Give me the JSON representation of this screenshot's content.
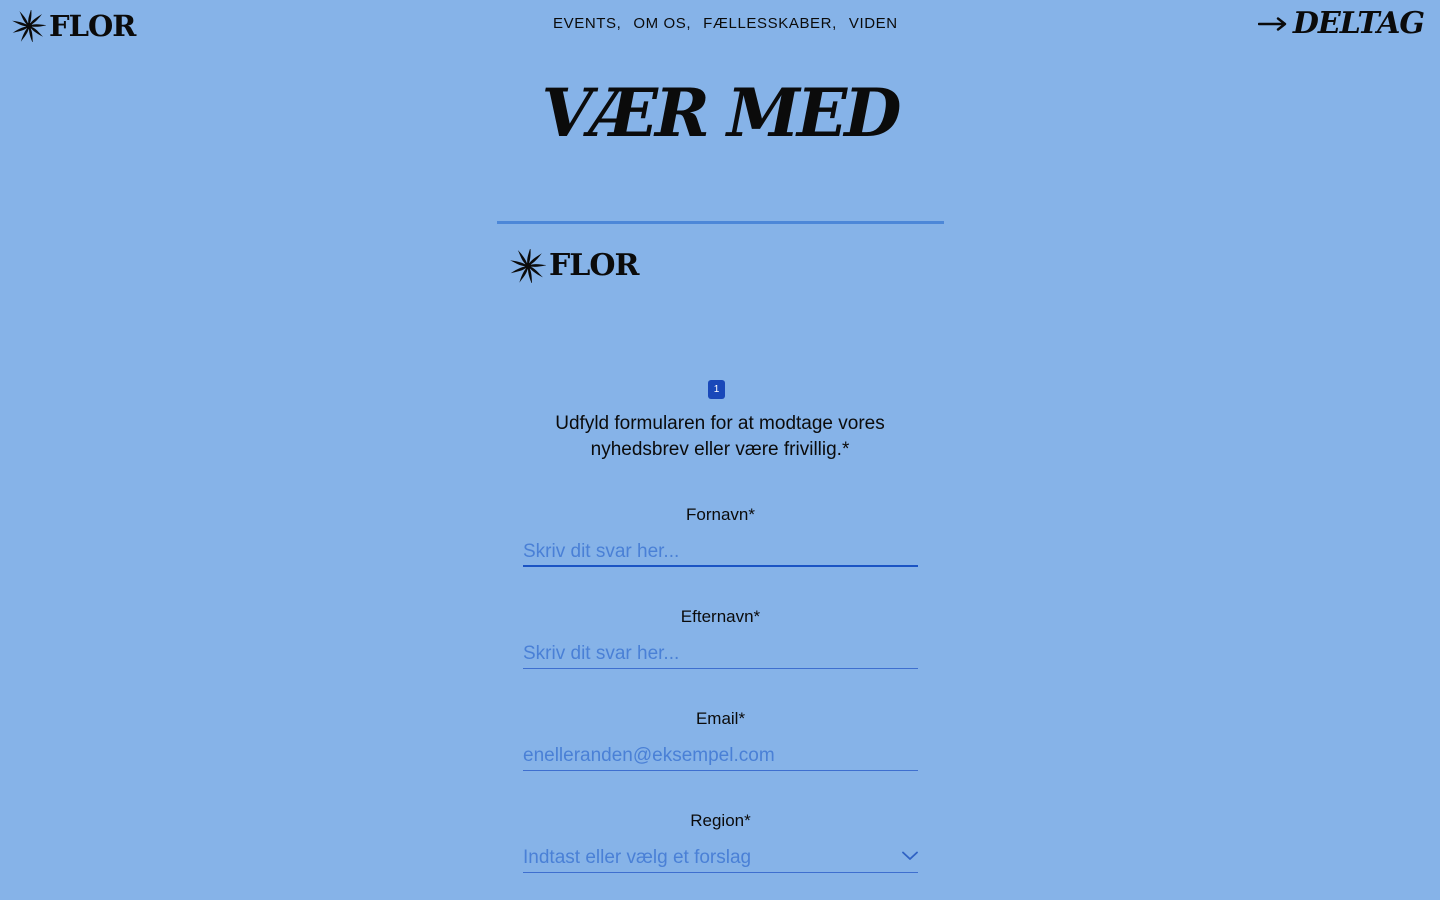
{
  "brand": {
    "name": "FLOR",
    "icon": "spiral-flower-icon"
  },
  "nav": {
    "items": [
      {
        "label": "EVENTS,"
      },
      {
        "label": "OM OS,"
      },
      {
        "label": "FÆLLESSKABER,"
      },
      {
        "label": "VIDEN"
      }
    ]
  },
  "header": {
    "cta_label": "DELTAG",
    "cta_icon": "arrow-right-icon"
  },
  "hero": {
    "title": "VÆR MED"
  },
  "form": {
    "step_number": "1",
    "question": "Udfyld formularen for at modtage vores nyhedsbrev eller være frivillig.*",
    "fields": {
      "first_name": {
        "label": "Fornavn*",
        "placeholder": "Skriv dit svar her...",
        "value": ""
      },
      "last_name": {
        "label": "Efternavn*",
        "placeholder": "Skriv dit svar her...",
        "value": ""
      },
      "email": {
        "label": "Email*",
        "placeholder": "enelleranden@eksempel.com",
        "value": ""
      },
      "region": {
        "label": "Region*",
        "placeholder": "Indtast eller vælg et forslag",
        "value": "",
        "icon": "chevron-down-icon"
      }
    }
  },
  "colors": {
    "background": "#86b3e8",
    "text": "#0b0b0b",
    "accent": "#1948b9",
    "placeholder": "#4a80d6",
    "divider": "#4c87d8"
  }
}
